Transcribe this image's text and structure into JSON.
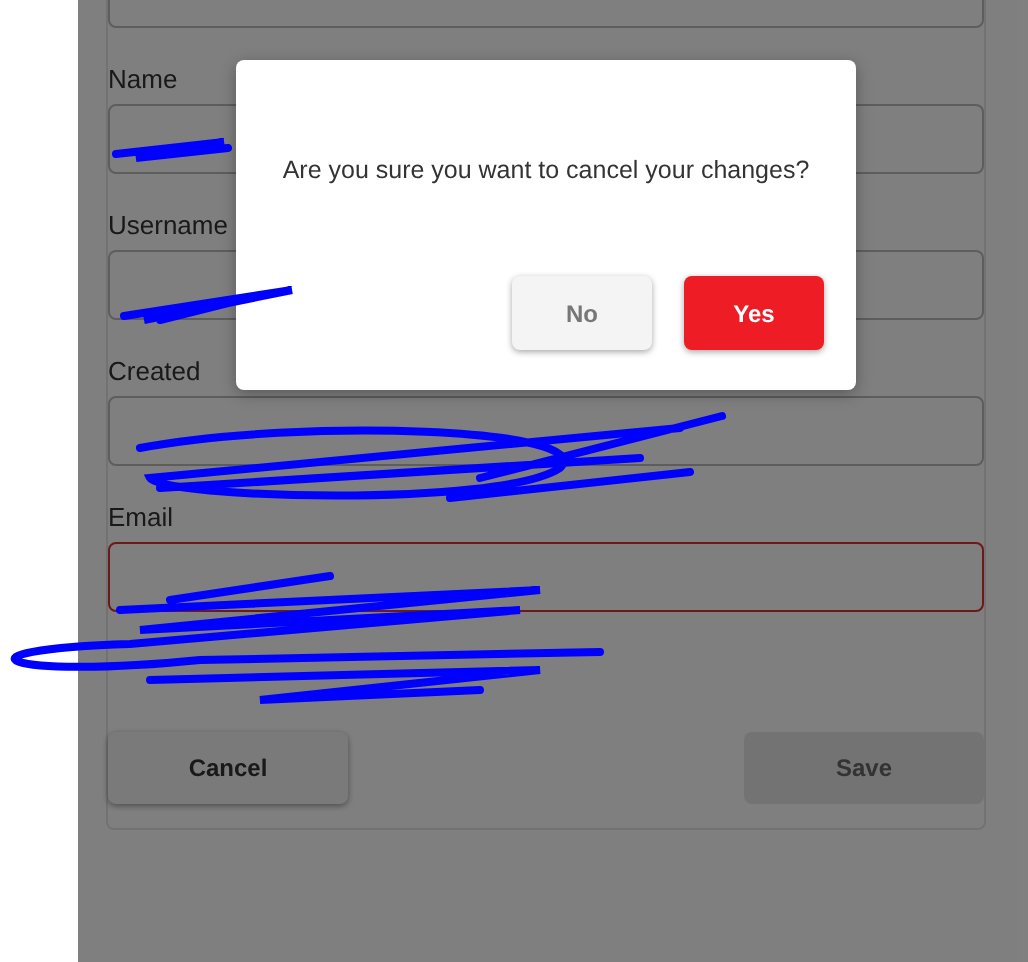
{
  "form": {
    "fields": [
      {
        "label": "Name",
        "invalid": false
      },
      {
        "label": "Username",
        "invalid": false
      },
      {
        "label": "Created",
        "invalid": false
      },
      {
        "label": "Email",
        "invalid": true
      }
    ],
    "buttons": [
      {
        "label": "Cancel",
        "disabled": false
      },
      {
        "label": "Save",
        "disabled": true
      }
    ]
  },
  "dialog": {
    "message": "Are you sure you want to cancel your changes?",
    "buttons": [
      {
        "label": "No",
        "kind": "secondary"
      },
      {
        "label": "Yes",
        "kind": "primary"
      }
    ]
  }
}
